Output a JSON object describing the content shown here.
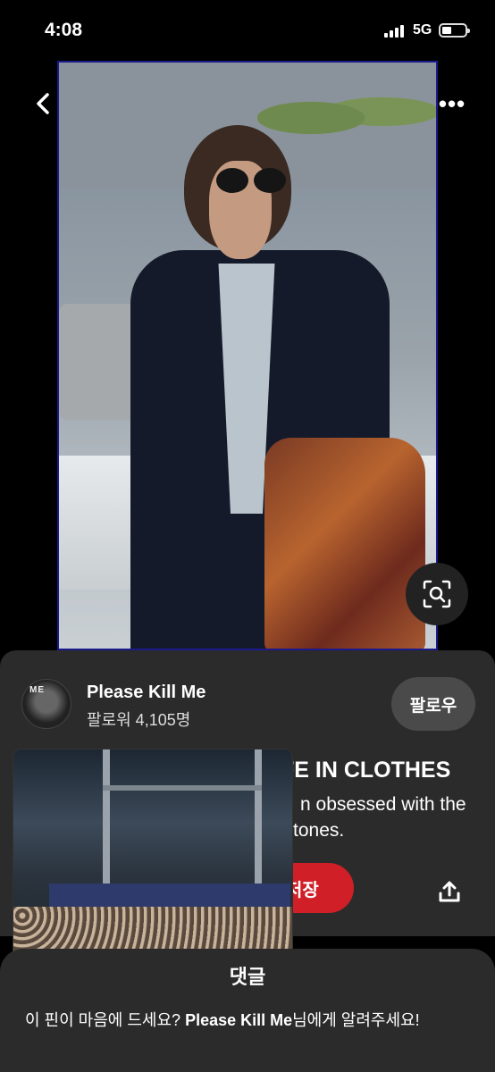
{
  "status_bar": {
    "time": "4:08",
    "network": "5G",
    "icons": [
      "signal-icon",
      "battery-icon"
    ]
  },
  "nav": {
    "back_icon": "chevron-left-icon",
    "more_icon": "more-horizontal-icon",
    "more_label": "•••"
  },
  "pin": {
    "lens_icon": "visual-search-icon",
    "title_visible": "FE IN CLOTHES",
    "description_line1": "n obsessed with the",
    "description_line2": "tones."
  },
  "account": {
    "name": "Please Kill Me",
    "followers": "팔로워 4,105명",
    "follow_label": "팔로우",
    "avatar_text": "ME"
  },
  "actions": {
    "save_label": "저장",
    "share_icon": "share-icon",
    "save_color": "#d01f27"
  },
  "comments": {
    "title": "댓글",
    "prompt_prefix": "이 핀이 마음에 드세요? ",
    "prompt_account": "Please Kill Me",
    "prompt_suffix": "님에게 알려주세요!"
  }
}
